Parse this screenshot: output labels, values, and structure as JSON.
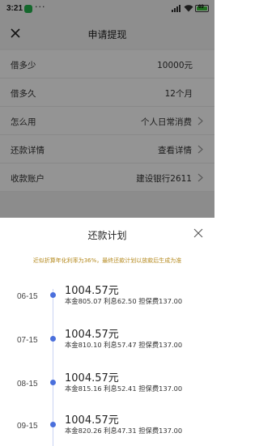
{
  "status_bar": {
    "time": "3:21",
    "dots": "···",
    "battery": "69"
  },
  "nav": {
    "title": "申请提现"
  },
  "form": {
    "rows": [
      {
        "label": "借多少",
        "value": "10000元"
      },
      {
        "label": "借多久",
        "value": "12个月"
      },
      {
        "label": "怎么用",
        "value": "个人日常消费"
      },
      {
        "label": "还款详情",
        "value": "查看详情"
      },
      {
        "label": "收款账户",
        "value": "建设银行2611"
      }
    ]
  },
  "sheet": {
    "title": "还款计划",
    "notice": "近似折算年化利率为36%，最终还款计划以放款后生成为准",
    "plans": [
      {
        "date": "06-15",
        "amount": "1004.57元",
        "detail": "本金805.07 利息62.50 担保费137.00"
      },
      {
        "date": "07-15",
        "amount": "1004.57元",
        "detail": "本金810.10 利息57.47 担保费137.00"
      },
      {
        "date": "08-15",
        "amount": "1004.57元",
        "detail": "本金815.16 利息52.41 担保费137.00"
      },
      {
        "date": "09-15",
        "amount": "1004.57元",
        "detail": "本金820.26 利息47.31 担保费137.00"
      }
    ]
  },
  "colors": {
    "accent": "#4a6fdc",
    "notice": "#b58a1f",
    "battery": "#3cc23c"
  }
}
